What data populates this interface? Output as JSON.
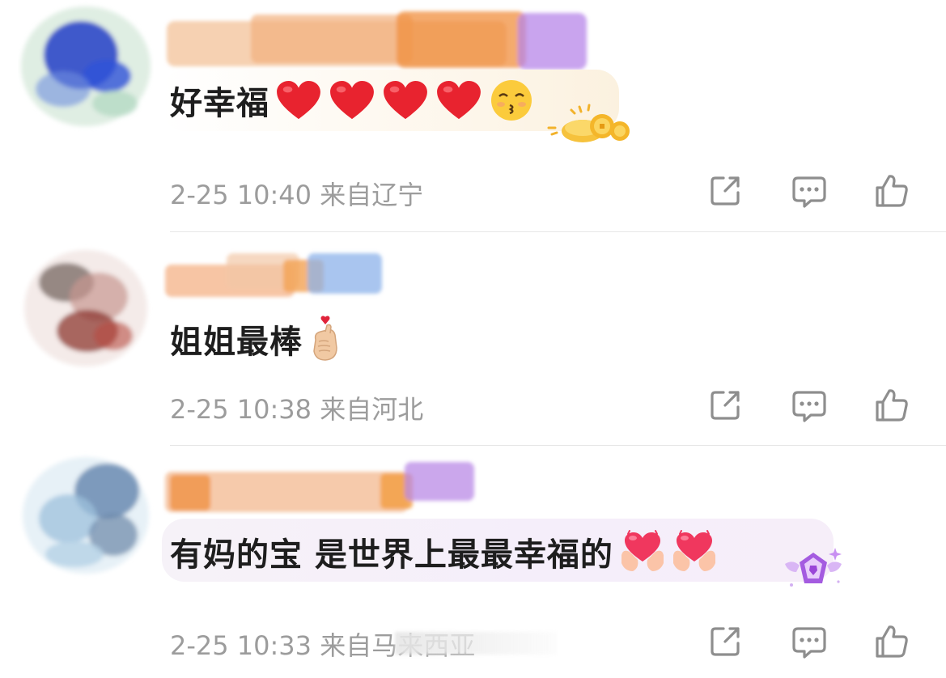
{
  "comments": [
    {
      "text": "好幸福",
      "emojis": [
        "heart-icon",
        "heart-icon",
        "heart-icon",
        "heart-icon",
        "kissing-face-icon"
      ],
      "badge": "gold-coins-badge",
      "time": "2-25 10:40",
      "location": "来自辽宁"
    },
    {
      "text": "姐姐最棒",
      "emojis": [
        "finger-heart-icon"
      ],
      "time": "2-25 10:38",
      "location": "来自河北"
    },
    {
      "text": "有妈的宝 是世界上最最幸福的",
      "emojis": [
        "heart-hands-icon",
        "heart-hands-icon"
      ],
      "badge": "purple-diamond-badge",
      "time": "2-25 10:33",
      "location": "来自马来西亚"
    }
  ],
  "actions": [
    "share-icon",
    "comment-icon",
    "like-icon"
  ],
  "colors": {
    "text": "#1e1e1e",
    "meta": "#9c9c9c",
    "icon": "#8e8e8e",
    "divider": "#e6e6e6",
    "heart": "#e8232f"
  }
}
